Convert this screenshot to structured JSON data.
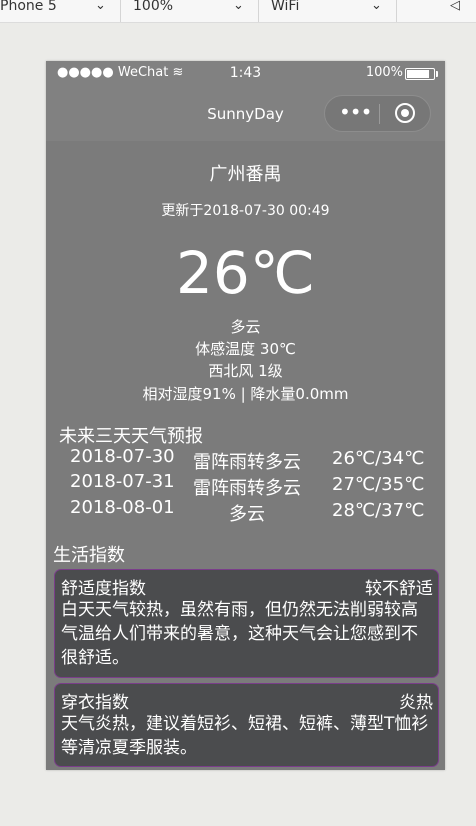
{
  "devtools": {
    "device": "Phone 5",
    "zoom": "100%",
    "network": "WiFi"
  },
  "status_bar": {
    "carrier": "●●●●● WeChat ≋",
    "time": "1:43",
    "battery": "100%"
  },
  "nav": {
    "title": "SunnyDay"
  },
  "current": {
    "city": "广州番禺",
    "updated": "更新于2018-07-30 00:49",
    "temperature": "26℃",
    "condition": "多云",
    "feels_like": "体感温度 30℃",
    "wind": "西北风 1级",
    "humidity_precip": "相对湿度91% | 降水量0.0mm"
  },
  "forecast": {
    "title": "未来三天天气预报",
    "days": [
      {
        "date": "2018-07-30",
        "desc": "雷阵雨转多云",
        "temp": "26℃/34℃"
      },
      {
        "date": "2018-07-31",
        "desc": "雷阵雨转多云",
        "temp": "27℃/35℃"
      },
      {
        "date": "2018-08-01",
        "desc": "多云",
        "temp": "28℃/37℃"
      }
    ]
  },
  "life": {
    "title": "生活指数",
    "cards": [
      {
        "name": "舒适度指数",
        "level": "较不舒适",
        "text": "白天天气较热，虽然有雨，但仍然无法削弱较高气温给人们带来的暑意，这种天气会让您感到不很舒适。"
      },
      {
        "name": "穿衣指数",
        "level": "炎热",
        "text": "天气炎热，建议着短衫、短裙、短裤、薄型T恤衫等清凉夏季服装。"
      }
    ]
  }
}
